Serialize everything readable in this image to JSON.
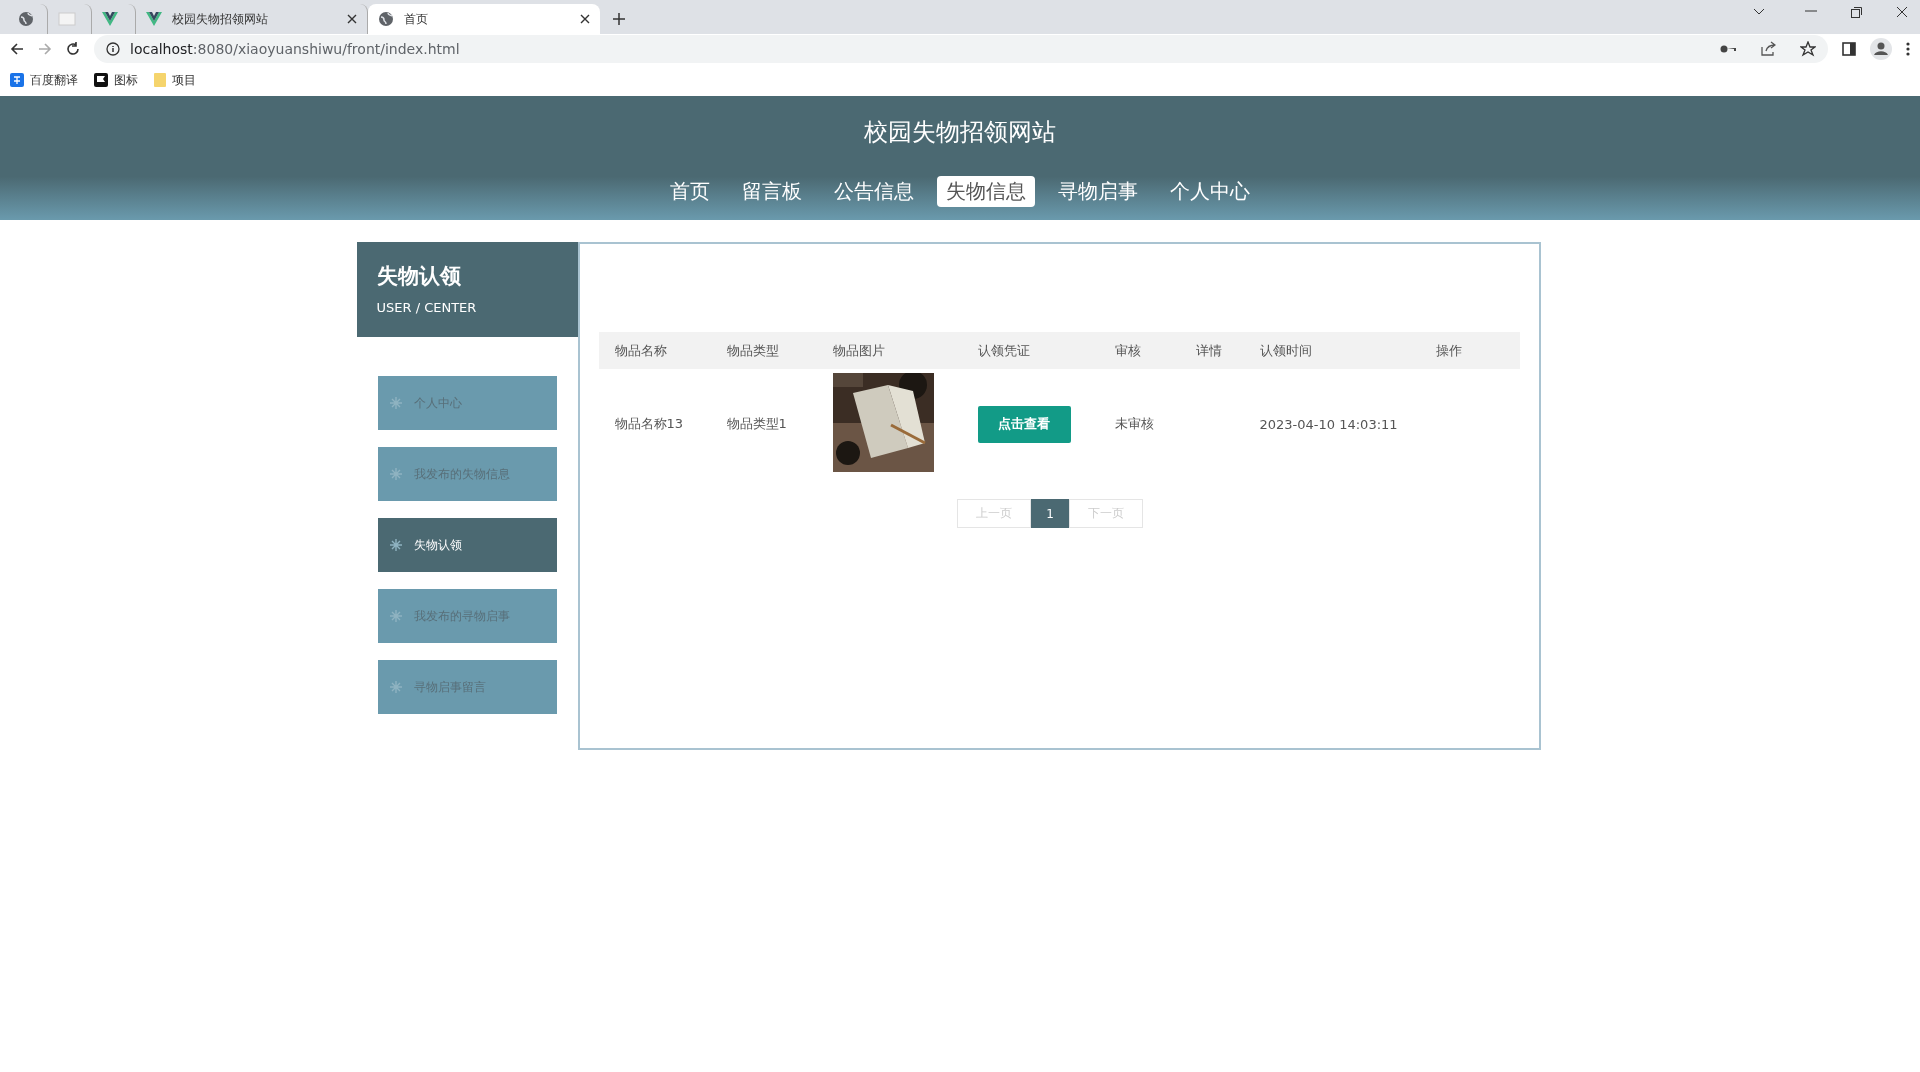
{
  "browser": {
    "tabs": [
      {
        "kind": "globe",
        "selected": false
      },
      {
        "kind": "page",
        "selected": false
      },
      {
        "kind": "vue",
        "selected": false
      },
      {
        "kind": "vue",
        "title": "校园失物招领网站",
        "selected": false
      },
      {
        "kind": "globe",
        "title": "首页",
        "selected": true
      }
    ],
    "url_host": "localhost",
    "url_rest": ":8080/xiaoyuanshiwu/front/index.html",
    "bookmarks": [
      {
        "kind": "translate",
        "label": "百度翻译"
      },
      {
        "kind": "flag",
        "label": "图标"
      },
      {
        "kind": "folder",
        "label": "项目"
      }
    ]
  },
  "site": {
    "title": "校园失物招领网站",
    "nav": [
      {
        "label": "首页",
        "selected": false
      },
      {
        "label": "留言板",
        "selected": false
      },
      {
        "label": "公告信息",
        "selected": false
      },
      {
        "label": "失物信息",
        "selected": true
      },
      {
        "label": "寻物启事",
        "selected": false
      },
      {
        "label": "个人中心",
        "selected": false
      }
    ]
  },
  "sidebar": {
    "title": "失物认领",
    "subtitle": "USER / CENTER",
    "items": [
      {
        "label": "个人中心",
        "selected": false
      },
      {
        "label": "我发布的失物信息",
        "selected": false
      },
      {
        "label": "失物认领",
        "selected": true
      },
      {
        "label": "我发布的寻物启事",
        "selected": false
      },
      {
        "label": "寻物启事留言",
        "selected": false
      }
    ]
  },
  "table": {
    "columns": [
      "物品名称",
      "物品类型",
      "物品图片",
      "认领凭证",
      "审核",
      "详情",
      "认领时间",
      "操作"
    ],
    "rows": [
      {
        "name": "物品名称13",
        "type": "物品类型1",
        "proof_button": "点击查看",
        "review": "未审核",
        "time": "2023-04-10 14:03:11"
      }
    ]
  },
  "pagination": {
    "prev": "上一页",
    "pages": [
      {
        "label": "1",
        "selected": true
      }
    ],
    "next": "下一页"
  }
}
